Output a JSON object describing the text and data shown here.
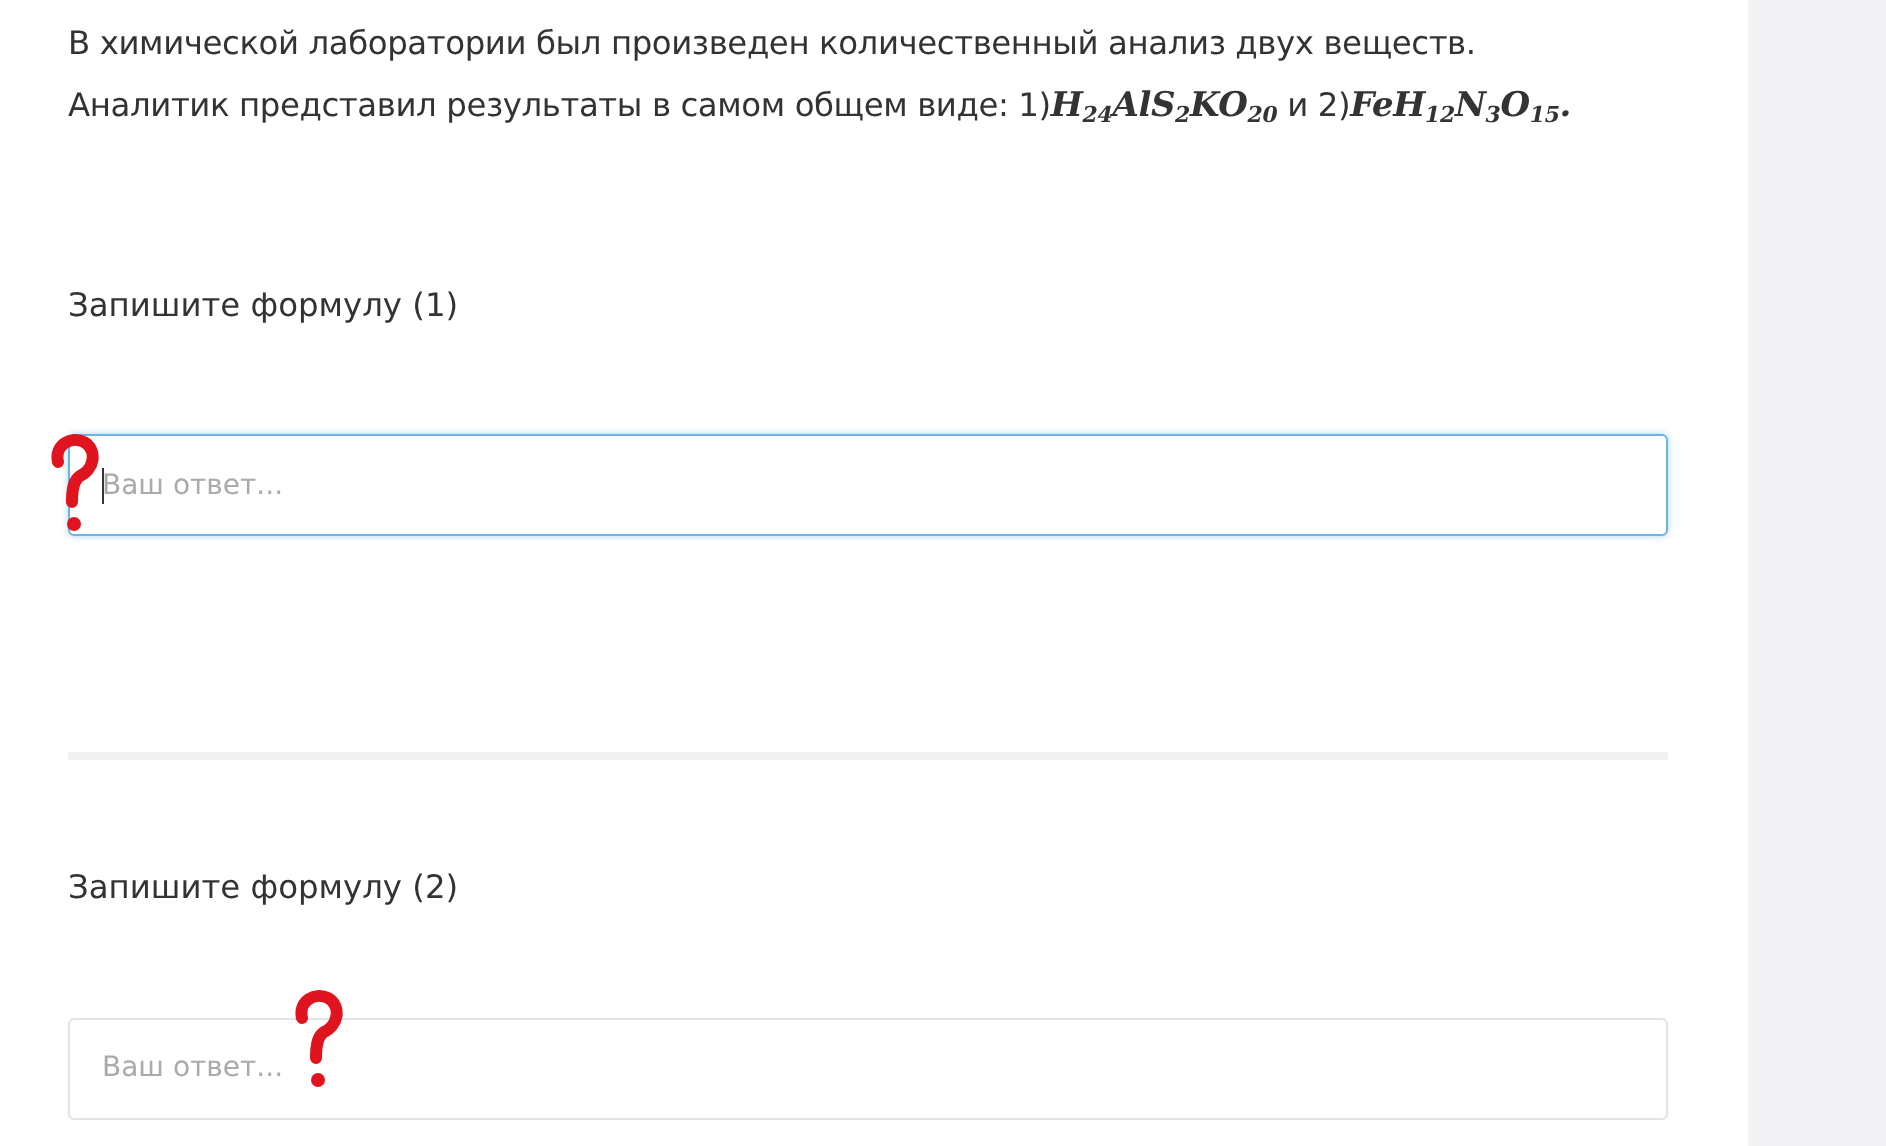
{
  "intro": {
    "lines": [
      [
        {
          "kind": "text",
          "text": "В химической лаборатории был произведен количественный анализ двух веществ."
        }
      ],
      [
        {
          "kind": "text",
          "text": "Аналитик представил результаты в самом общем виде: 1)"
        },
        {
          "kind": "formula",
          "text": "H$_{24}$AlS$_{2}$KO$_{20}$"
        },
        {
          "kind": "text",
          "text": " и 2)"
        },
        {
          "kind": "formula",
          "text": "FeH$_{12}$N$_{3}$O$_{15}$"
        },
        {
          "kind": "formula",
          "text": "."
        }
      ]
    ]
  },
  "questions": [
    {
      "label": "Запишите формулу (1)",
      "placeholder": "Ваш ответ...",
      "focused": true
    },
    {
      "label": "Запишите формулу (2)",
      "placeholder": "Ваш ответ...",
      "focused": false
    }
  ]
}
